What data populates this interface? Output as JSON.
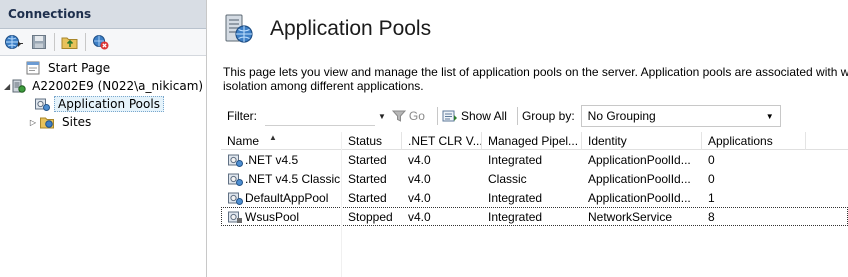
{
  "connections": {
    "title": "Connections",
    "toolbar": [
      "globe-connect-icon",
      "save-icon",
      "folder-up-icon",
      "disconnect-icon"
    ],
    "tree": [
      {
        "label": "Start Page",
        "icon": "start-page-icon",
        "expander": "",
        "level": 0
      },
      {
        "label": "A22002E9 (N022\\a_nikicam)",
        "icon": "server-icon",
        "expander": "◢",
        "level": 0
      },
      {
        "label": "Application Pools",
        "icon": "app-pools-icon",
        "expander": "",
        "level": 1,
        "selected": true
      },
      {
        "label": "Sites",
        "icon": "sites-icon",
        "expander": "▷",
        "level": 1
      }
    ]
  },
  "main": {
    "title": "Application Pools",
    "description_line1": "This page lets you view and manage the list of application pools on the server. Application pools are associated with wo",
    "description_line2": "isolation among different applications."
  },
  "filterbar": {
    "filter_label": "Filter:",
    "filter_value": "",
    "go_label": "Go",
    "show_all_label": "Show All",
    "group_by_label": "Group by:",
    "group_by_value": "No Grouping"
  },
  "grid": {
    "columns": [
      "Name",
      "Status",
      ".NET CLR V...",
      "Managed Pipel...",
      "Identity",
      "Applications"
    ],
    "rows": [
      {
        "name": ".NET v4.5",
        "status": "Started",
        "clr": "v4.0",
        "pipeline": "Integrated",
        "identity": "ApplicationPoolId...",
        "apps": "0"
      },
      {
        "name": ".NET v4.5 Classic",
        "status": "Started",
        "clr": "v4.0",
        "pipeline": "Classic",
        "identity": "ApplicationPoolId...",
        "apps": "0"
      },
      {
        "name": "DefaultAppPool",
        "status": "Started",
        "clr": "v4.0",
        "pipeline": "Integrated",
        "identity": "ApplicationPoolId...",
        "apps": "1"
      },
      {
        "name": "WsusPool",
        "status": "Stopped",
        "clr": "v4.0",
        "pipeline": "Integrated",
        "identity": "NetworkService",
        "apps": "8"
      }
    ]
  },
  "colors": {
    "panel_header_bg": "#d8dde4",
    "panel_header_text": "#1e2f4d",
    "selection_bg": "#e5f3fb"
  }
}
